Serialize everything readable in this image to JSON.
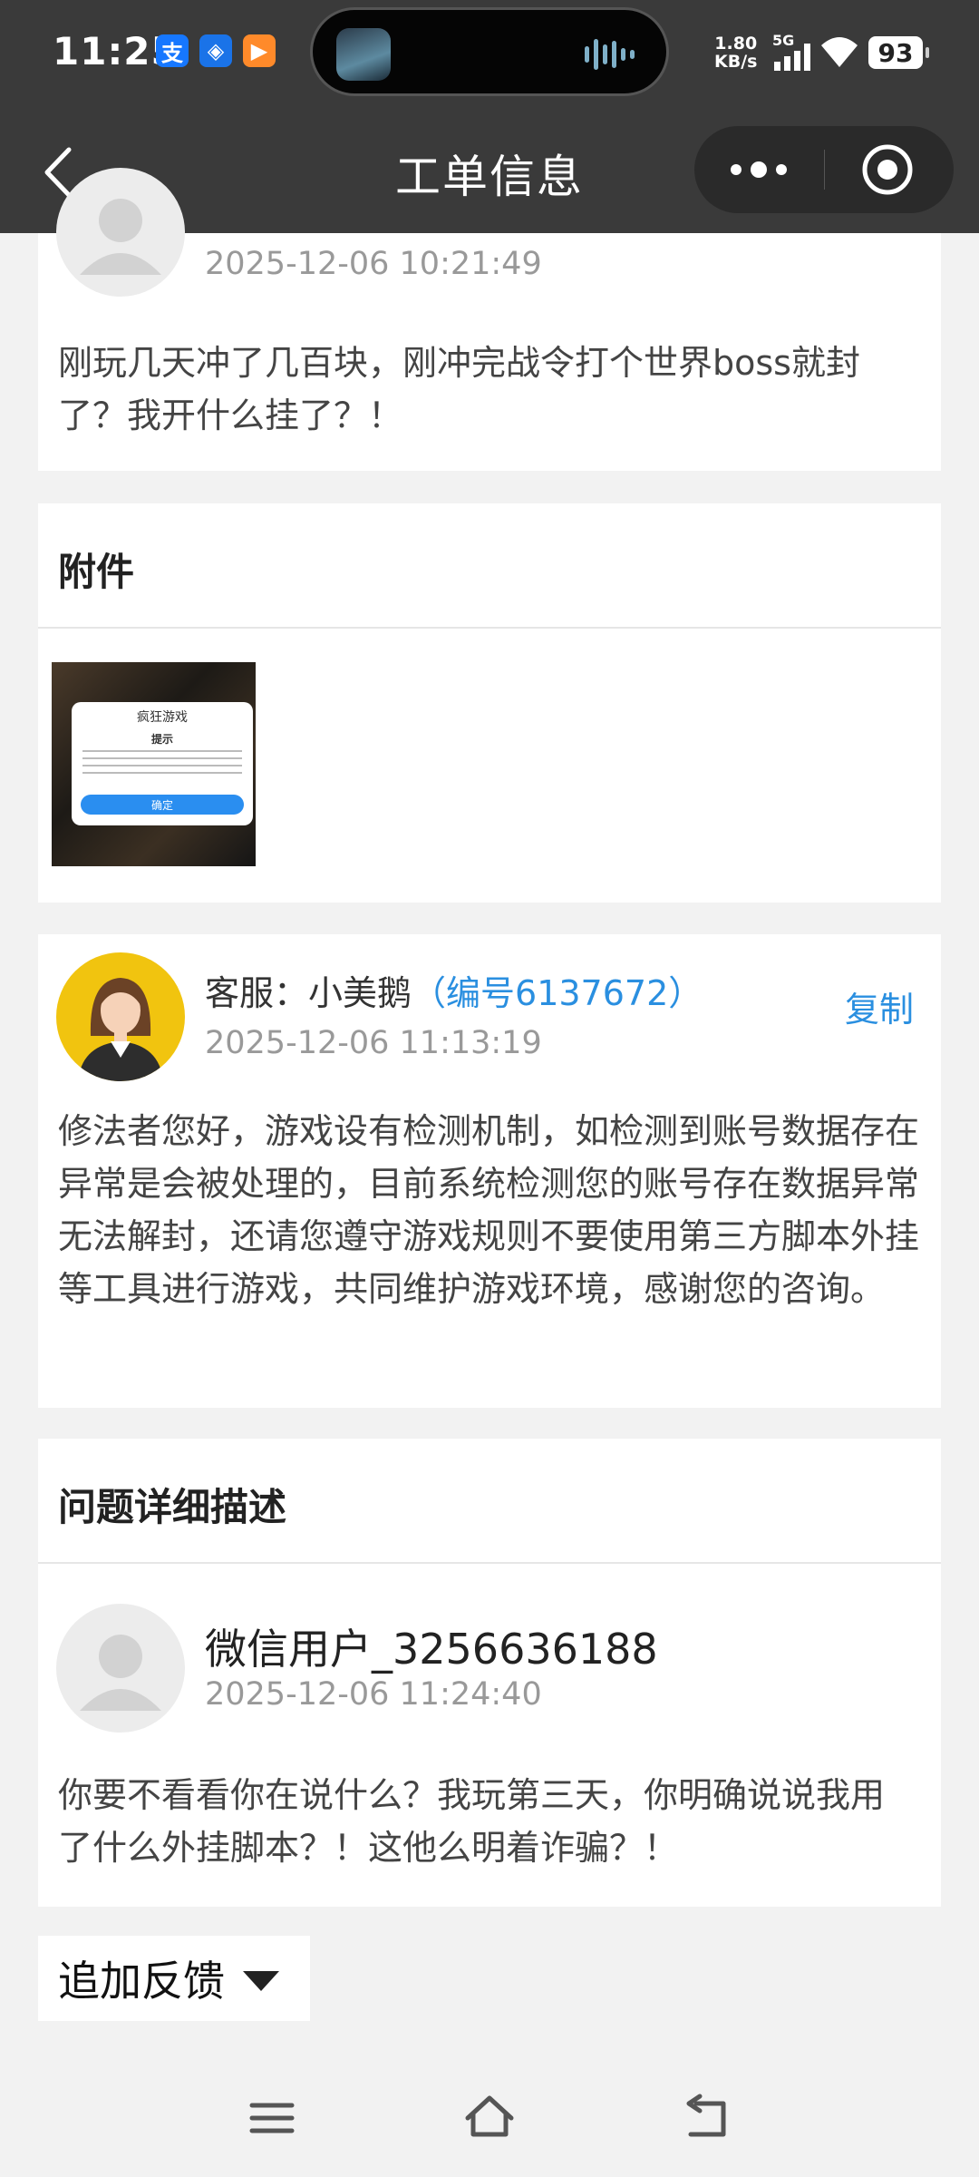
{
  "status_bar": {
    "time": "11:25",
    "apps": [
      {
        "icon": "alipay-icon",
        "glyph": "支",
        "color": "#1677ff"
      },
      {
        "icon": "blue-app-icon",
        "glyph": "◈",
        "color": "#1a73e8"
      },
      {
        "icon": "video-app-icon",
        "glyph": "▶",
        "color": "#ff8a2a"
      }
    ],
    "net_speed": "1.80",
    "net_unit": "KB/s",
    "network": "5G",
    "battery": "93"
  },
  "header": {
    "title": "工单信息"
  },
  "top_message": {
    "timestamp": "2025-12-06 10:21:49",
    "content": "刚玩几天冲了几百块，刚冲完战令打个世界boss就封了？我开什么挂了？！"
  },
  "attachments": {
    "heading": "附件",
    "thumb": {
      "logo": "疯狂游戏",
      "title": "提示",
      "button": "确定"
    }
  },
  "agent_reply": {
    "name": "客服：小美鹅",
    "agent_id": "（编号6137672）",
    "copy_label": "复制",
    "timestamp": "2025-12-06 11:13:19",
    "content": "修法者您好，游戏设有检测机制，如检测到账号数据存在异常是会被处理的，目前系统检测您的账号存在数据异常无法解封，还请您遵守游戏规则不要使用第三方脚本外挂等工具进行游戏，共同维护游戏环境，感谢您的咨询。"
  },
  "problem_detail": {
    "heading": "问题详细描述",
    "user_name": "微信用户_3256636188",
    "timestamp": "2025-12-06 11:24:40",
    "content": "你要不看看你在说什么？我玩第三天，你明确说说我用了什么外挂脚本？！这他么明着诈骗？！"
  },
  "feedback": {
    "label": "追加反馈"
  }
}
